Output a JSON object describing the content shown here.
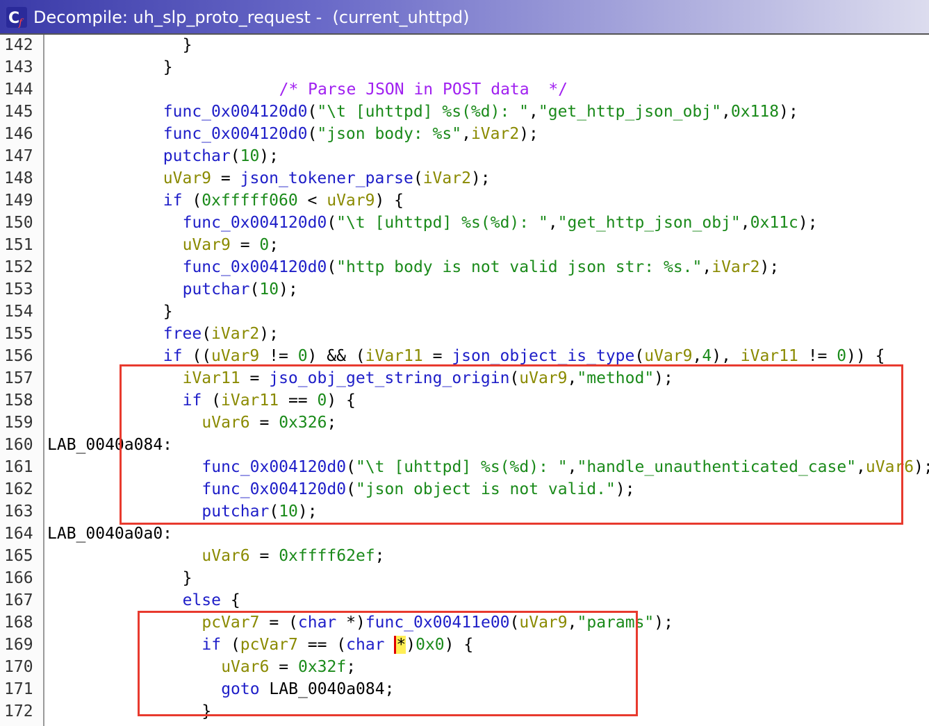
{
  "window": {
    "title": "Decompile: uh_slp_proto_request -  (current_uhttpd)",
    "icon": "decompiler-icon"
  },
  "lines": [
    {
      "no": "142",
      "indent": 7,
      "tokens": [
        [
          "p",
          "}"
        ]
      ]
    },
    {
      "no": "143",
      "indent": 6,
      "tokens": [
        [
          "p",
          "}"
        ]
      ]
    },
    {
      "no": "144",
      "indent": 12,
      "tokens": [
        [
          "c",
          "/* Parse JSON in POST data  */"
        ]
      ]
    },
    {
      "no": "145",
      "indent": 6,
      "tokens": [
        [
          "f",
          "func_0x004120d0"
        ],
        [
          "p",
          "("
        ],
        [
          "s",
          "\"\\t [uhttpd] %s(%d): \""
        ],
        [
          "p",
          ","
        ],
        [
          "s",
          "\"get_http_json_obj\""
        ],
        [
          "p",
          ","
        ],
        [
          "n",
          "0x118"
        ],
        [
          "p",
          ");"
        ]
      ]
    },
    {
      "no": "146",
      "indent": 6,
      "tokens": [
        [
          "f",
          "func_0x004120d0"
        ],
        [
          "p",
          "("
        ],
        [
          "s",
          "\"json body: %s\""
        ],
        [
          "p",
          ","
        ],
        [
          "v",
          "iVar2"
        ],
        [
          "p",
          ");"
        ]
      ]
    },
    {
      "no": "147",
      "indent": 6,
      "tokens": [
        [
          "f",
          "putchar"
        ],
        [
          "p",
          "("
        ],
        [
          "n",
          "10"
        ],
        [
          "p",
          ");"
        ]
      ]
    },
    {
      "no": "148",
      "indent": 6,
      "tokens": [
        [
          "v",
          "uVar9"
        ],
        [
          "p",
          " = "
        ],
        [
          "f",
          "json_tokener_parse"
        ],
        [
          "p",
          "("
        ],
        [
          "v",
          "iVar2"
        ],
        [
          "p",
          ");"
        ]
      ]
    },
    {
      "no": "149",
      "indent": 6,
      "tokens": [
        [
          "k",
          "if"
        ],
        [
          "p",
          " ("
        ],
        [
          "n",
          "0xfffff060"
        ],
        [
          "p",
          " < "
        ],
        [
          "v",
          "uVar9"
        ],
        [
          "p",
          ") {"
        ]
      ]
    },
    {
      "no": "150",
      "indent": 7,
      "tokens": [
        [
          "f",
          "func_0x004120d0"
        ],
        [
          "p",
          "("
        ],
        [
          "s",
          "\"\\t [uhttpd] %s(%d): \""
        ],
        [
          "p",
          ","
        ],
        [
          "s",
          "\"get_http_json_obj\""
        ],
        [
          "p",
          ","
        ],
        [
          "n",
          "0x11c"
        ],
        [
          "p",
          ");"
        ]
      ]
    },
    {
      "no": "151",
      "indent": 7,
      "tokens": [
        [
          "v",
          "uVar9"
        ],
        [
          "p",
          " = "
        ],
        [
          "n",
          "0"
        ],
        [
          "p",
          ";"
        ]
      ]
    },
    {
      "no": "152",
      "indent": 7,
      "tokens": [
        [
          "f",
          "func_0x004120d0"
        ],
        [
          "p",
          "("
        ],
        [
          "s",
          "\"http body is not valid json str: %s.\""
        ],
        [
          "p",
          ","
        ],
        [
          "v",
          "iVar2"
        ],
        [
          "p",
          ");"
        ]
      ]
    },
    {
      "no": "153",
      "indent": 7,
      "tokens": [
        [
          "f",
          "putchar"
        ],
        [
          "p",
          "("
        ],
        [
          "n",
          "10"
        ],
        [
          "p",
          ");"
        ]
      ]
    },
    {
      "no": "154",
      "indent": 6,
      "tokens": [
        [
          "p",
          "}"
        ]
      ]
    },
    {
      "no": "155",
      "indent": 6,
      "tokens": [
        [
          "f",
          "free"
        ],
        [
          "p",
          "("
        ],
        [
          "v",
          "iVar2"
        ],
        [
          "p",
          ");"
        ]
      ]
    },
    {
      "no": "156",
      "indent": 6,
      "tokens": [
        [
          "k",
          "if"
        ],
        [
          "p",
          " (("
        ],
        [
          "v",
          "uVar9"
        ],
        [
          "p",
          " != "
        ],
        [
          "n",
          "0"
        ],
        [
          "p",
          ") && ("
        ],
        [
          "v",
          "iVar11"
        ],
        [
          "p",
          " = "
        ],
        [
          "f",
          "json_object_is_type"
        ],
        [
          "p",
          "("
        ],
        [
          "v",
          "uVar9"
        ],
        [
          "p",
          ","
        ],
        [
          "n",
          "4"
        ],
        [
          "p",
          "), "
        ],
        [
          "v",
          "iVar11"
        ],
        [
          "p",
          " != "
        ],
        [
          "n",
          "0"
        ],
        [
          "p",
          ")) {"
        ]
      ]
    },
    {
      "no": "157",
      "indent": 7,
      "tokens": [
        [
          "v",
          "iVar11"
        ],
        [
          "p",
          " = "
        ],
        [
          "f",
          "jso_obj_get_string_origin"
        ],
        [
          "p",
          "("
        ],
        [
          "v",
          "uVar9"
        ],
        [
          "p",
          ","
        ],
        [
          "s",
          "\"method\""
        ],
        [
          "p",
          ");"
        ]
      ]
    },
    {
      "no": "158",
      "indent": 7,
      "tokens": [
        [
          "k",
          "if"
        ],
        [
          "p",
          " ("
        ],
        [
          "v",
          "iVar11"
        ],
        [
          "p",
          " == "
        ],
        [
          "n",
          "0"
        ],
        [
          "p",
          ") {"
        ]
      ]
    },
    {
      "no": "159",
      "indent": 8,
      "tokens": [
        [
          "v",
          "uVar6"
        ],
        [
          "p",
          " = "
        ],
        [
          "n",
          "0x326"
        ],
        [
          "p",
          ";"
        ]
      ]
    },
    {
      "no": "160",
      "indent": 0,
      "tokens": [
        [
          "p",
          "LAB_0040a084:"
        ]
      ]
    },
    {
      "no": "161",
      "indent": 8,
      "tokens": [
        [
          "f",
          "func_0x004120d0"
        ],
        [
          "p",
          "("
        ],
        [
          "s",
          "\"\\t [uhttpd] %s(%d): \""
        ],
        [
          "p",
          ","
        ],
        [
          "s",
          "\"handle_unauthenticated_case\""
        ],
        [
          "p",
          ","
        ],
        [
          "v",
          "uVar6"
        ],
        [
          "p",
          ");"
        ]
      ]
    },
    {
      "no": "162",
      "indent": 8,
      "tokens": [
        [
          "f",
          "func_0x004120d0"
        ],
        [
          "p",
          "("
        ],
        [
          "s",
          "\"json object is not valid.\""
        ],
        [
          "p",
          ");"
        ]
      ]
    },
    {
      "no": "163",
      "indent": 8,
      "tokens": [
        [
          "f",
          "putchar"
        ],
        [
          "p",
          "("
        ],
        [
          "n",
          "10"
        ],
        [
          "p",
          ");"
        ]
      ]
    },
    {
      "no": "164",
      "indent": 0,
      "tokens": [
        [
          "p",
          "LAB_0040a0a0:"
        ]
      ]
    },
    {
      "no": "165",
      "indent": 8,
      "tokens": [
        [
          "v",
          "uVar6"
        ],
        [
          "p",
          " = "
        ],
        [
          "n",
          "0xffff62ef"
        ],
        [
          "p",
          ";"
        ]
      ]
    },
    {
      "no": "166",
      "indent": 7,
      "tokens": [
        [
          "p",
          "}"
        ]
      ]
    },
    {
      "no": "167",
      "indent": 7,
      "tokens": [
        [
          "k",
          "else"
        ],
        [
          "p",
          " {"
        ]
      ]
    },
    {
      "no": "168",
      "indent": 8,
      "tokens": [
        [
          "v",
          "pcVar7"
        ],
        [
          "p",
          " = ("
        ],
        [
          "k",
          "char"
        ],
        [
          "p",
          " *)"
        ],
        [
          "f",
          "func_0x00411e00"
        ],
        [
          "p",
          "("
        ],
        [
          "v",
          "uVar9"
        ],
        [
          "p",
          ","
        ],
        [
          "s",
          "\"params\""
        ],
        [
          "p",
          ");"
        ]
      ]
    },
    {
      "no": "169",
      "indent": 8,
      "tokens": [
        [
          "k",
          "if"
        ],
        [
          "p",
          " ("
        ],
        [
          "v",
          "pcVar7"
        ],
        [
          "p",
          " == ("
        ],
        [
          "k",
          "char"
        ],
        [
          "p",
          " "
        ],
        [
          "hl",
          "*"
        ],
        [
          "p",
          ")"
        ],
        [
          "n",
          "0x0"
        ],
        [
          "p",
          ") {"
        ]
      ]
    },
    {
      "no": "170",
      "indent": 9,
      "tokens": [
        [
          "v",
          "uVar6"
        ],
        [
          "p",
          " = "
        ],
        [
          "n",
          "0x32f"
        ],
        [
          "p",
          ";"
        ]
      ]
    },
    {
      "no": "171",
      "indent": 9,
      "tokens": [
        [
          "k",
          "goto"
        ],
        [
          "p",
          " LAB_0040a084;"
        ]
      ]
    },
    {
      "no": "172",
      "indent": 8,
      "tokens": [
        [
          "p",
          "}"
        ]
      ]
    }
  ],
  "highlight_colors": {
    "box": "#e83a2e",
    "cursor": "#ffee55"
  }
}
